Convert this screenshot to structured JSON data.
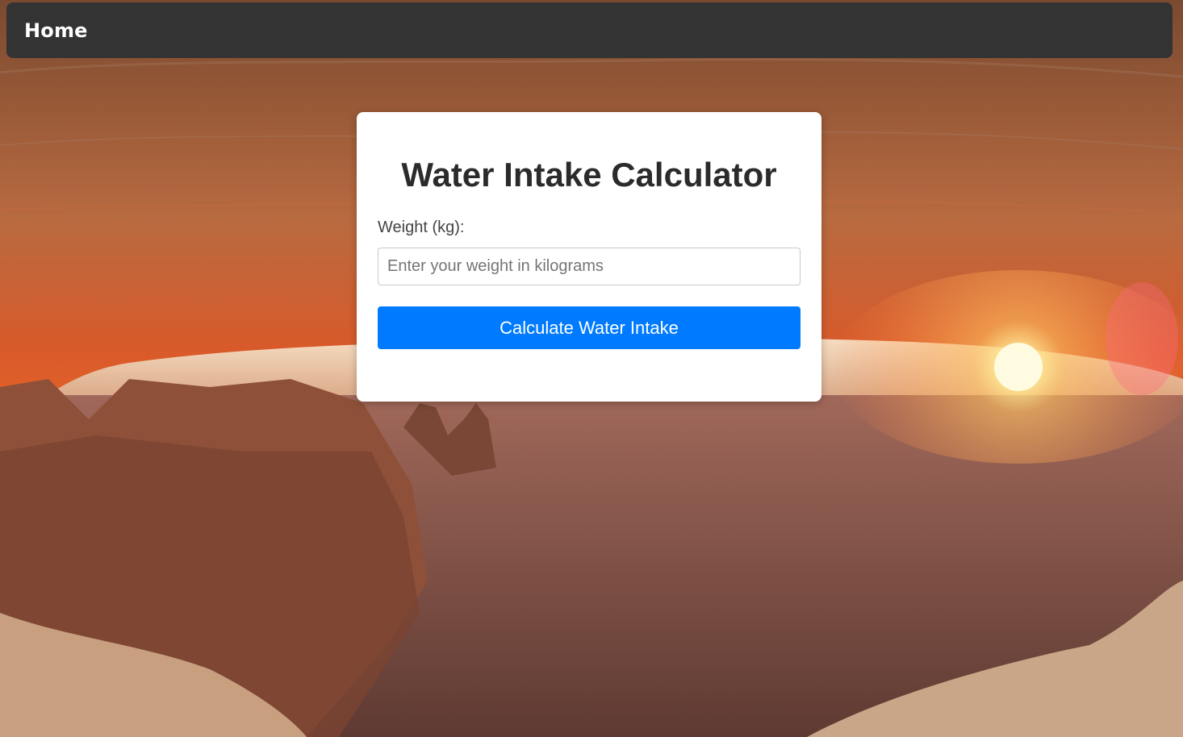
{
  "nav": {
    "home_label": "Home"
  },
  "calculator": {
    "title": "Water Intake Calculator",
    "weight_label": "Weight (kg):",
    "weight_input_value": "",
    "weight_input_placeholder": "Enter your weight in kilograms",
    "calculate_button_label": "Calculate Water Intake"
  },
  "colors": {
    "navbar": "#333333",
    "button": "#007bff",
    "card": "#ffffff",
    "title_text": "#2b2b2b"
  }
}
